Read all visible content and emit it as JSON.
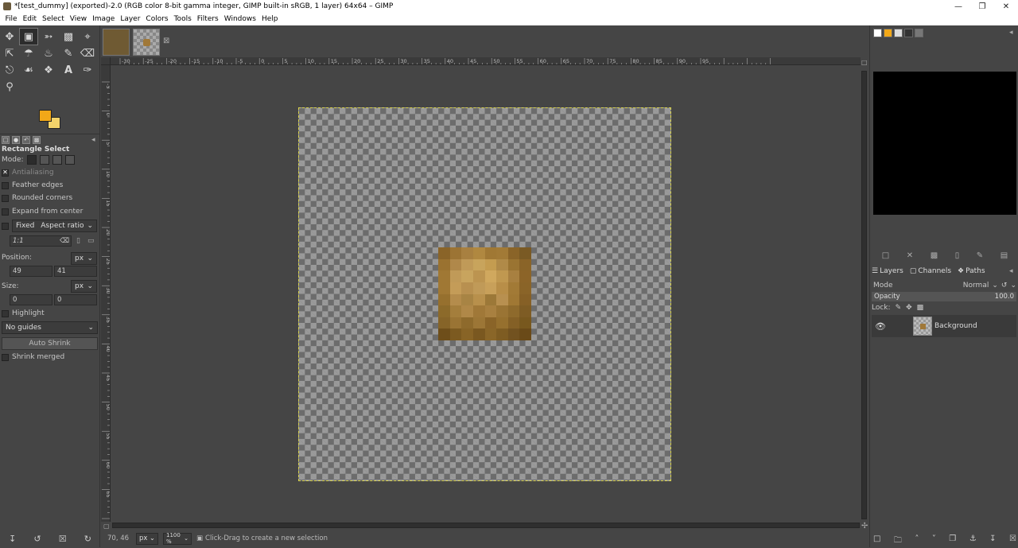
{
  "window": {
    "title": "*[test_dummy] (exported)-2.0 (RGB color 8-bit gamma integer, GIMP built-in sRGB, 1 layer) 64x64 – GIMP"
  },
  "menu": [
    "File",
    "Edit",
    "Select",
    "View",
    "Image",
    "Layer",
    "Colors",
    "Tools",
    "Filters",
    "Windows",
    "Help"
  ],
  "tool_options": {
    "title": "Rectangle Select",
    "mode_label": "Mode:",
    "antialiasing": "Antialiasing",
    "feather": "Feather edges",
    "rounded": "Rounded corners",
    "expand": "Expand from center",
    "fixed": "Fixed",
    "aspect": "Aspect ratio",
    "ratio_value": "1:1",
    "position_label": "Position:",
    "position_unit": "px",
    "pos_x": "49",
    "pos_y": "41",
    "size_label": "Size:",
    "size_unit": "px",
    "size_w": "0",
    "size_h": "0",
    "highlight": "Highlight",
    "guides": "No guides",
    "auto_shrink": "Auto Shrink",
    "shrink_merged": "Shrink merged"
  },
  "ruler": {
    "top_labels": [
      "-30",
      "-25",
      "-20",
      "-15",
      "-10",
      "-5",
      "0",
      "5",
      "10",
      "15",
      "20",
      "25",
      "30",
      "35",
      "40",
      "45",
      "50",
      "55",
      "60",
      "65",
      "70",
      "75",
      "80",
      "85",
      "90",
      "95"
    ],
    "left_labels": [
      "-5",
      "0",
      "5",
      "10",
      "15",
      "20",
      "25",
      "30",
      "35",
      "40",
      "45",
      "50",
      "55",
      "60",
      "65",
      "70"
    ]
  },
  "status": {
    "coords": "70, 46",
    "unit": "px",
    "zoom": "1100 %",
    "message": "Click-Drag to create a new selection"
  },
  "layers": {
    "tab_layers": "Layers",
    "tab_channels": "Channels",
    "tab_paths": "Paths",
    "mode_label": "Mode",
    "mode_value": "Normal",
    "opacity_label": "Opacity",
    "opacity_value": "100.0",
    "lock_label": "Lock:",
    "layer_name": "Background"
  },
  "colors": {
    "fg": "#f2a818",
    "bg": "#f3d36a"
  },
  "sprite_pixels": [
    [
      "#8a6428",
      "#9c7434",
      "#a88040",
      "#b08840",
      "#a07834",
      "#a27a36",
      "#8a6428",
      "#7a5a24"
    ],
    [
      "#9a7230",
      "#b0884a",
      "#c09a58",
      "#c8a45c",
      "#c49c50",
      "#b08a48",
      "#9a7432",
      "#8a6428"
    ],
    [
      "#a07834",
      "#c09a58",
      "#c8a45e",
      "#bc9450",
      "#d0a85e",
      "#c09850",
      "#a88040",
      "#8c6428"
    ],
    [
      "#a07834",
      "#c49c58",
      "#b89050",
      "#c09a58",
      "#c8a05a",
      "#b88e48",
      "#a27a36",
      "#8a6428"
    ],
    [
      "#96702e",
      "#b48c4c",
      "#a88444",
      "#b8904c",
      "#9c7838",
      "#b89050",
      "#a07834",
      "#866026"
    ],
    [
      "#8c6a2a",
      "#a47e3c",
      "#b08848",
      "#a07838",
      "#a88040",
      "#9a7434",
      "#8e6a2c",
      "#7e5c24"
    ],
    [
      "#866428",
      "#9a7434",
      "#8e6a2c",
      "#9c7636",
      "#8a6428",
      "#96702e",
      "#846026",
      "#78581e"
    ],
    [
      "#6e4e1a",
      "#7c5a20",
      "#886426",
      "#7a5820",
      "#8a6628",
      "#7e5c22",
      "#725220",
      "#6a4a18"
    ]
  ]
}
